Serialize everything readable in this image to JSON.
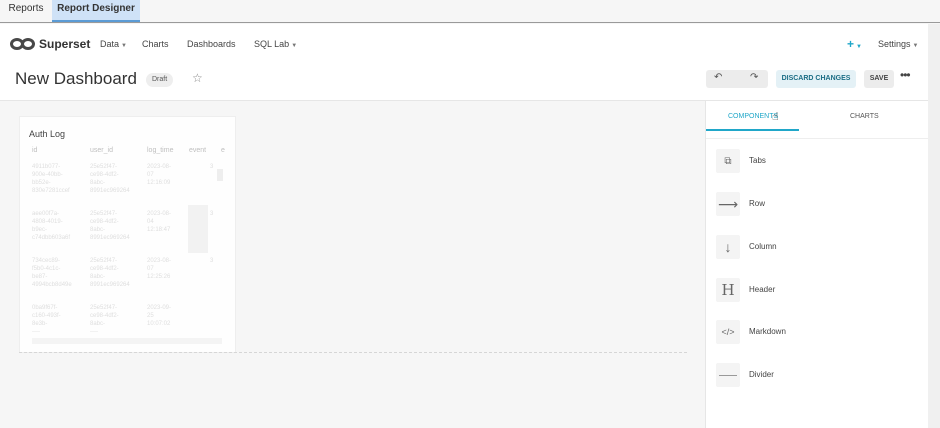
{
  "top_tabs": [
    "Reports",
    "Report Designer"
  ],
  "brand": {
    "name": "Superset"
  },
  "nav": [
    {
      "label": "Data",
      "has_caret": true
    },
    {
      "label": "Charts",
      "has_caret": false
    },
    {
      "label": "Dashboards",
      "has_caret": false
    },
    {
      "label": "SQL Lab",
      "has_caret": true
    }
  ],
  "header_right": {
    "plus_label": "+",
    "settings_label": "Settings"
  },
  "dashboard": {
    "title": "New Dashboard",
    "status": "Draft",
    "discard_label": "DISCARD CHANGES",
    "save_label": "SAVE"
  },
  "chart": {
    "title": "Auth Log",
    "columns": [
      "id",
      "user_id",
      "log_time",
      "event",
      "e"
    ],
    "rows": [
      [
        "4911b077-\n900e-40bb-\nbb52e-\n830e7281ccef",
        "25e52f47-\nce98-4df2-\n8abc-\n8991ec969264",
        "2023-08-\n07\n12:16:09",
        "3"
      ],
      [
        "aee00f7a-\n4808-4019-\nb9ec-\nc74dbb603a6f",
        "25e52f47-\nce98-4df2-\n8abc-\n8991ec969264",
        "2023-08-\n04\n12:18:47",
        "3"
      ],
      [
        "734cec89-\nf5b0-4c1c-\nbe87-\n4994bcb8d49e",
        "25e52f47-\nce98-4df2-\n8abc-\n8991ec969264",
        "2023-08-\n07\n12:25:26",
        "3"
      ],
      [
        "0ba9f67f-\nc160-493f-\n8e3b-\n----",
        "25e52f47-\nce98-4df2-\n8abc-\n----",
        "2023-09-\n25\n10:07:02",
        ""
      ]
    ]
  },
  "panel": {
    "tabs": [
      "COMPONENTS",
      "CHARTS"
    ],
    "components": [
      {
        "label": "Tabs",
        "icon": "tabs-icon"
      },
      {
        "label": "Row",
        "icon": "row-arrow-icon"
      },
      {
        "label": "Column",
        "icon": "column-arrow-icon"
      },
      {
        "label": "Header",
        "icon": "header-h-icon"
      },
      {
        "label": "Markdown",
        "icon": "code-icon"
      },
      {
        "label": "Divider",
        "icon": "divider-icon"
      }
    ]
  },
  "colors": {
    "accent": "#20a7c9",
    "tab_active_bg": "#cfe2f7"
  }
}
